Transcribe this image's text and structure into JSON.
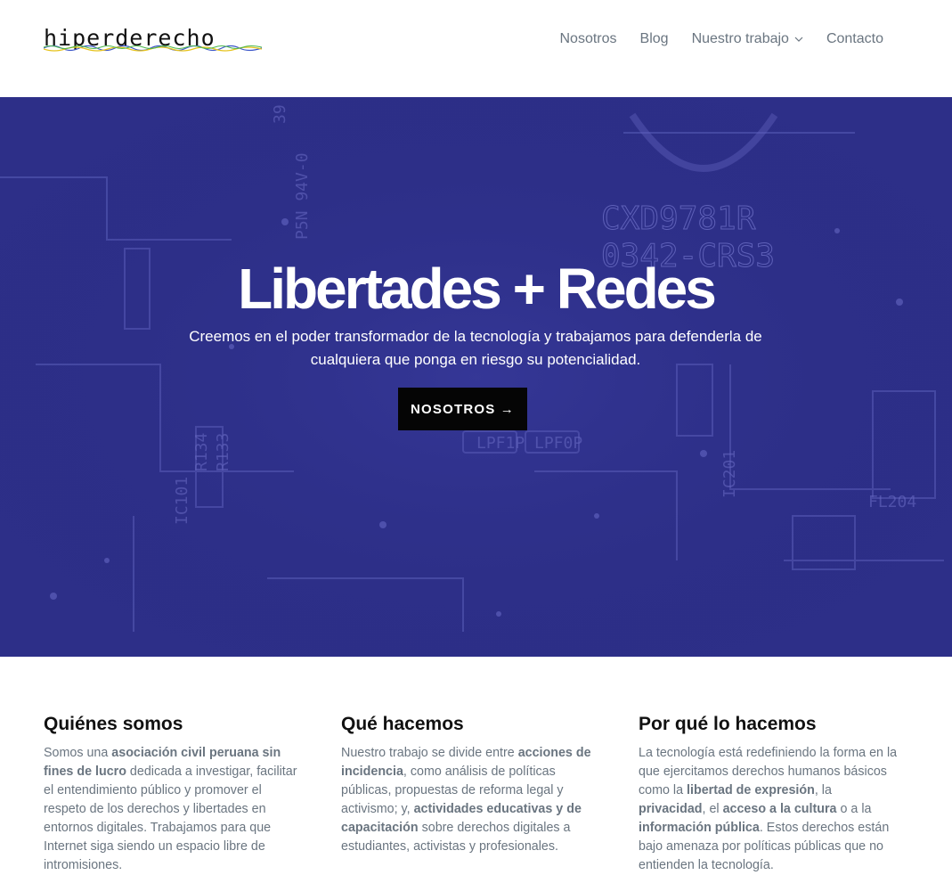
{
  "header": {
    "logo_text": "hiperderecho",
    "nav": [
      {
        "label": "Nosotros"
      },
      {
        "label": "Blog"
      },
      {
        "label": "Nuestro trabajo"
      },
      {
        "label": "Contacto"
      }
    ]
  },
  "hero": {
    "title": "Libertades + Redes",
    "subtitle_line1": "Creemos en el poder transformador de la tecnología y trabajamos para defenderla de",
    "subtitle_line2": "cualquiera que ponga en riesgo su potencialidad.",
    "button_label": "NOSOTROS →",
    "bg_texts": [
      "CXD9781R",
      "0342-CRS3",
      "LPF1P",
      "LPF0P",
      "R134",
      "R133",
      "IC101",
      "IC201",
      "FL204",
      "P5N 94V-0",
      "39"
    ]
  },
  "columns": [
    {
      "title": "Quiénes somos",
      "paragraph": [
        {
          "t": "Somos una "
        },
        {
          "t": "asociación civil peruana sin fines de lucro",
          "b": true
        },
        {
          "t": " dedicada a investigar, facilitar el entendimiento público y promover el respeto de los derechos y libertades en entornos digitales. Trabajamos para que Internet siga siendo un espacio libre de intromisiones."
        }
      ]
    },
    {
      "title": "Qué hacemos",
      "paragraph": [
        {
          "t": "Nuestro trabajo se divide entre "
        },
        {
          "t": "acciones de incidencia",
          "b": true
        },
        {
          "t": ", como análisis de políticas públicas, propuestas de reforma legal y activismo; y, "
        },
        {
          "t": "actividades educativas y de capacitación",
          "b": true
        },
        {
          "t": " sobre derechos digitales a estudiantes, activistas y profesionales."
        }
      ]
    },
    {
      "title": "Por qué lo hacemos",
      "paragraph": [
        {
          "t": "La tecnología está redefiniendo la forma en la que ejercitamos derechos humanos básicos como la "
        },
        {
          "t": "libertad de expresión",
          "b": true
        },
        {
          "t": ", la "
        },
        {
          "t": "privacidad",
          "b": true
        },
        {
          "t": ", el "
        },
        {
          "t": "acceso a la cultura",
          "b": true
        },
        {
          "t": " o a la "
        },
        {
          "t": "información pública",
          "b": true
        },
        {
          "t": ". Estos derechos están bajo amenaza por políticas públicas que no entienden la tecnología."
        }
      ]
    }
  ],
  "colors": {
    "hero_bg": "#2d2f88",
    "nav_text": "#6a7580",
    "button_bg": "#050505"
  }
}
